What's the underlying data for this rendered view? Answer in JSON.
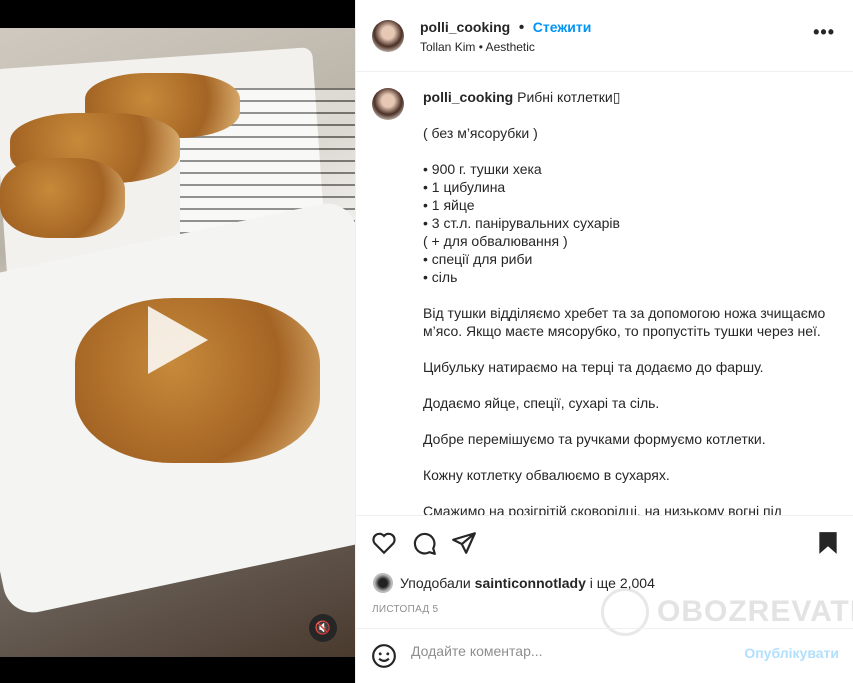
{
  "post": {
    "username": "polli_cooking",
    "follow_label": "Стежити",
    "separator": "•",
    "audio": "Tollan Kim • Aesthetic",
    "more_label": "•••"
  },
  "caption": {
    "username": "polli_cooking",
    "title": "Рибні котлетки▯",
    "paragraphs": [
      "( без м’ясорубки )",
      "• 900 г. тушки хека\n• 1 цибулина\n• 1 яйце\n• 3 ст.л. панірувальних сухарів\n( + для обвалювання )\n• спеції для риби\n• сіль",
      "Від тушки відділяємо хребет та за допомогою ножа зчищаємо м’ясо. Якщо маєте мясорубко, то пропустіть тушки через неї.",
      "Цибульку натираємо на терці та додаємо до фаршу.",
      "Додаємо яйце, спеції, сухарі та сіль.",
      "Добре перемішуємо та ручками формуємо котлетки.",
      "Кожну котлетку обвалюємо в сухарях.",
      "Смажимо на розігрітій сковорідці, на низькому вогні під"
    ]
  },
  "likes": {
    "prefix": "Уподобали ",
    "user": "sainticonnotlady",
    "suffix": " і ще 2,004"
  },
  "date": "ЛИСТОПАД 5",
  "watermark": "OBOZREVATEL",
  "comment": {
    "placeholder": "Додайте коментар...",
    "publish_label": "Опублікувати"
  },
  "icons": {
    "like": "heart-icon",
    "comment": "comment-icon",
    "share": "paper-plane-icon",
    "save": "bookmark-icon",
    "emoji": "smiley-icon",
    "mute": "muted-speaker-icon",
    "play": "play-icon"
  }
}
